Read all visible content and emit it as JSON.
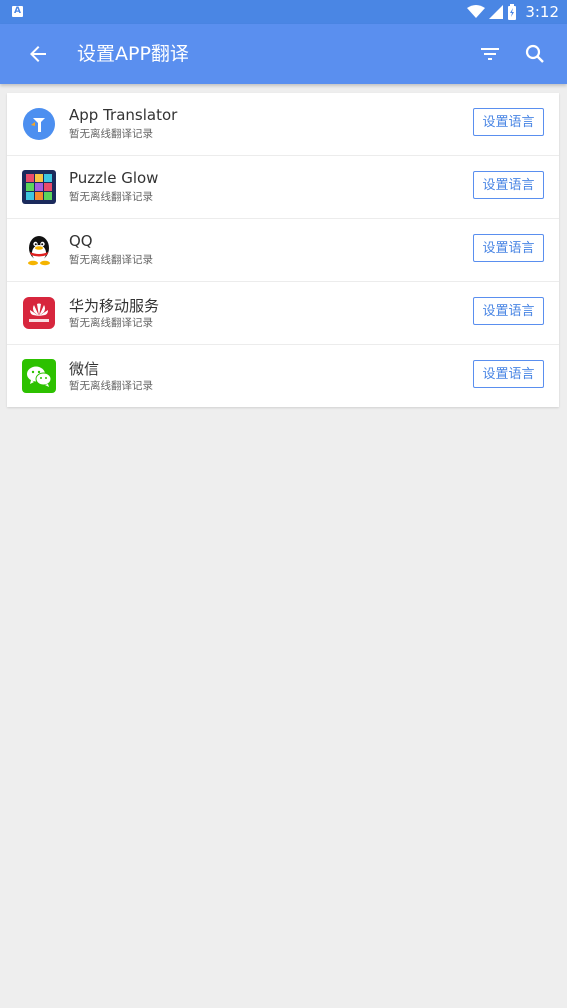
{
  "status_bar": {
    "time": "3:12",
    "notification_letter": "A"
  },
  "app_bar": {
    "title": "设置APP翻译"
  },
  "apps": [
    {
      "name": "App Translator",
      "subtitle": "暂无离线翻译记录",
      "button": "设置语言",
      "icon": "app-translator-icon"
    },
    {
      "name": "Puzzle Glow",
      "subtitle": "暂无离线翻译记录",
      "button": "设置语言",
      "icon": "puzzle-glow-icon"
    },
    {
      "name": "QQ",
      "subtitle": "暂无离线翻译记录",
      "button": "设置语言",
      "icon": "qq-penguin-icon"
    },
    {
      "name": "华为移动服务",
      "subtitle": "暂无离线翻译记录",
      "button": "设置语言",
      "icon": "huawei-icon"
    },
    {
      "name": "微信",
      "subtitle": "暂无离线翻译记录",
      "button": "设置语言",
      "icon": "wechat-icon"
    }
  ],
  "colors": {
    "primary": "#5a8fef",
    "status_bar": "#4a86e4",
    "background": "#eeeeee"
  }
}
